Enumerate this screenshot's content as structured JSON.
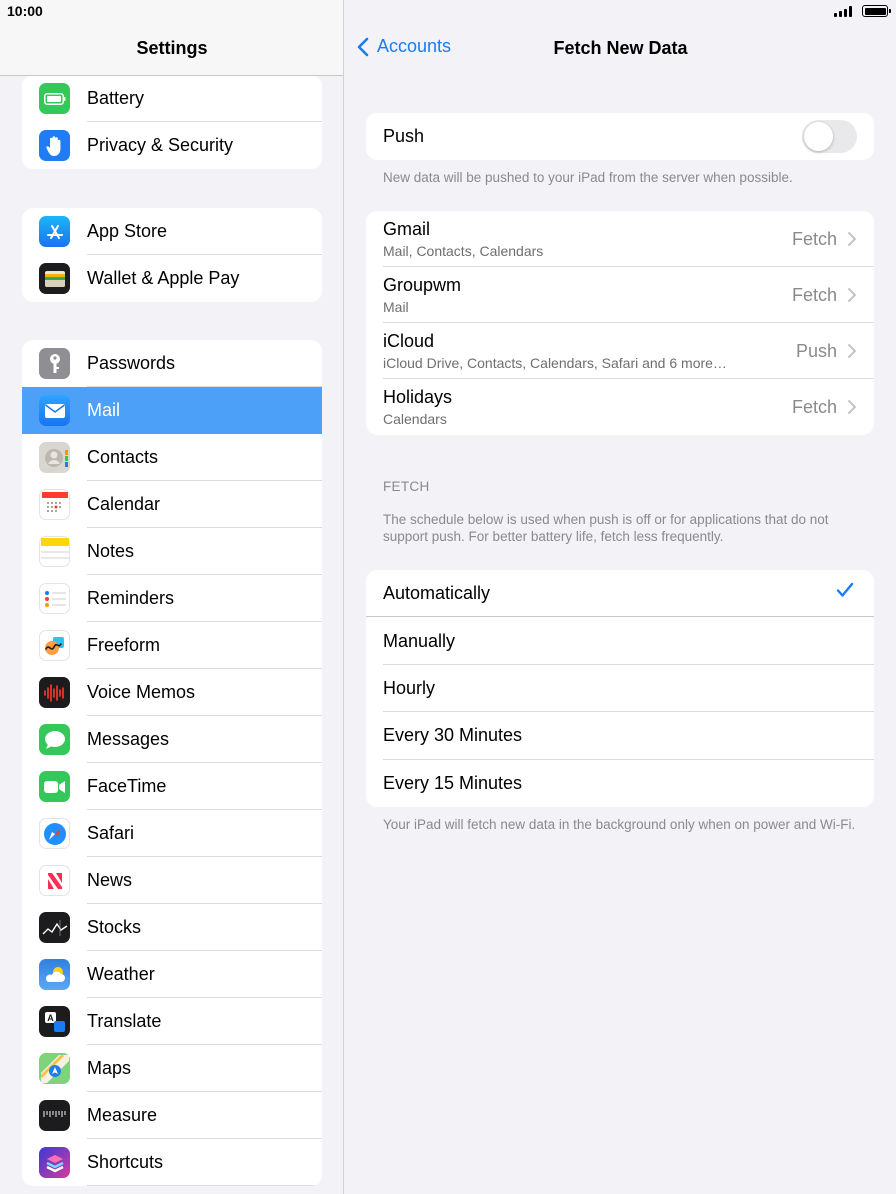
{
  "status": {
    "time": "10:00"
  },
  "sidebar": {
    "title": "Settings",
    "group1": [
      {
        "label": "Battery",
        "icon": "battery-icon",
        "color": "#34c759"
      },
      {
        "label": "Privacy & Security",
        "icon": "hand-icon",
        "color": "#1f7cf5"
      }
    ],
    "group2": [
      {
        "label": "App Store",
        "icon": "app-store-icon",
        "color": "#1e90ff"
      },
      {
        "label": "Wallet & Apple Pay",
        "icon": "wallet-icon",
        "color": "#1c1c1e"
      }
    ],
    "group3": [
      {
        "label": "Passwords",
        "icon": "key-icon",
        "color": "#8e8e93"
      },
      {
        "label": "Mail",
        "icon": "mail-icon",
        "color": "#1f8af5",
        "selected": true
      },
      {
        "label": "Contacts",
        "icon": "contacts-icon",
        "color": "#c7c2bb"
      },
      {
        "label": "Calendar",
        "icon": "calendar-icon",
        "color": "#ffffff"
      },
      {
        "label": "Notes",
        "icon": "notes-icon",
        "color": "#ffd60a"
      },
      {
        "label": "Reminders",
        "icon": "reminders-icon",
        "color": "#ffffff"
      },
      {
        "label": "Freeform",
        "icon": "freeform-icon",
        "color": "#ffffff"
      },
      {
        "label": "Voice Memos",
        "icon": "voice-memos-icon",
        "color": "#1c1c1e"
      },
      {
        "label": "Messages",
        "icon": "messages-icon",
        "color": "#34c759"
      },
      {
        "label": "FaceTime",
        "icon": "facetime-icon",
        "color": "#34c759"
      },
      {
        "label": "Safari",
        "icon": "safari-icon",
        "color": "#ffffff"
      },
      {
        "label": "News",
        "icon": "news-icon",
        "color": "#ffffff"
      },
      {
        "label": "Stocks",
        "icon": "stocks-icon",
        "color": "#1c1c1e"
      },
      {
        "label": "Weather",
        "icon": "weather-icon",
        "color": "#2f7fe0"
      },
      {
        "label": "Translate",
        "icon": "translate-icon",
        "color": "#1c1c1e"
      },
      {
        "label": "Maps",
        "icon": "maps-icon",
        "color": "#7fd37a"
      },
      {
        "label": "Measure",
        "icon": "measure-icon",
        "color": "#1c1c1e"
      },
      {
        "label": "Shortcuts",
        "icon": "shortcuts-icon",
        "color": "#5b3fd6"
      }
    ]
  },
  "detail": {
    "back_label": "Accounts",
    "title": "Fetch New Data",
    "push": {
      "label": "Push",
      "on": false,
      "note": "New data will be pushed to your iPad from the server when possible."
    },
    "accounts": [
      {
        "name": "Gmail",
        "sub": "Mail, Contacts, Calendars",
        "value": "Fetch"
      },
      {
        "name": "Groupwm",
        "sub": "Mail",
        "value": "Fetch"
      },
      {
        "name": "iCloud",
        "sub": "iCloud Drive, Contacts, Calendars, Safari and 6 more…",
        "value": "Push"
      },
      {
        "name": "Holidays",
        "sub": "Calendars",
        "value": "Fetch"
      }
    ],
    "fetch_header": "FETCH",
    "fetch_note": "The schedule below is used when push is off or for applications that do not support push. For better battery life, fetch less frequently.",
    "options": [
      {
        "label": "Automatically",
        "selected": true
      },
      {
        "label": "Manually",
        "selected": false
      },
      {
        "label": "Hourly",
        "selected": false
      },
      {
        "label": "Every 30 Minutes",
        "selected": false
      },
      {
        "label": "Every 15 Minutes",
        "selected": false
      }
    ],
    "footer_note": "Your iPad will fetch new data in the background only when on power and Wi-Fi."
  },
  "colors": {
    "accent": "#1a7cf2",
    "selected_row": "#4da0f7",
    "background": "#f2f2f7"
  }
}
